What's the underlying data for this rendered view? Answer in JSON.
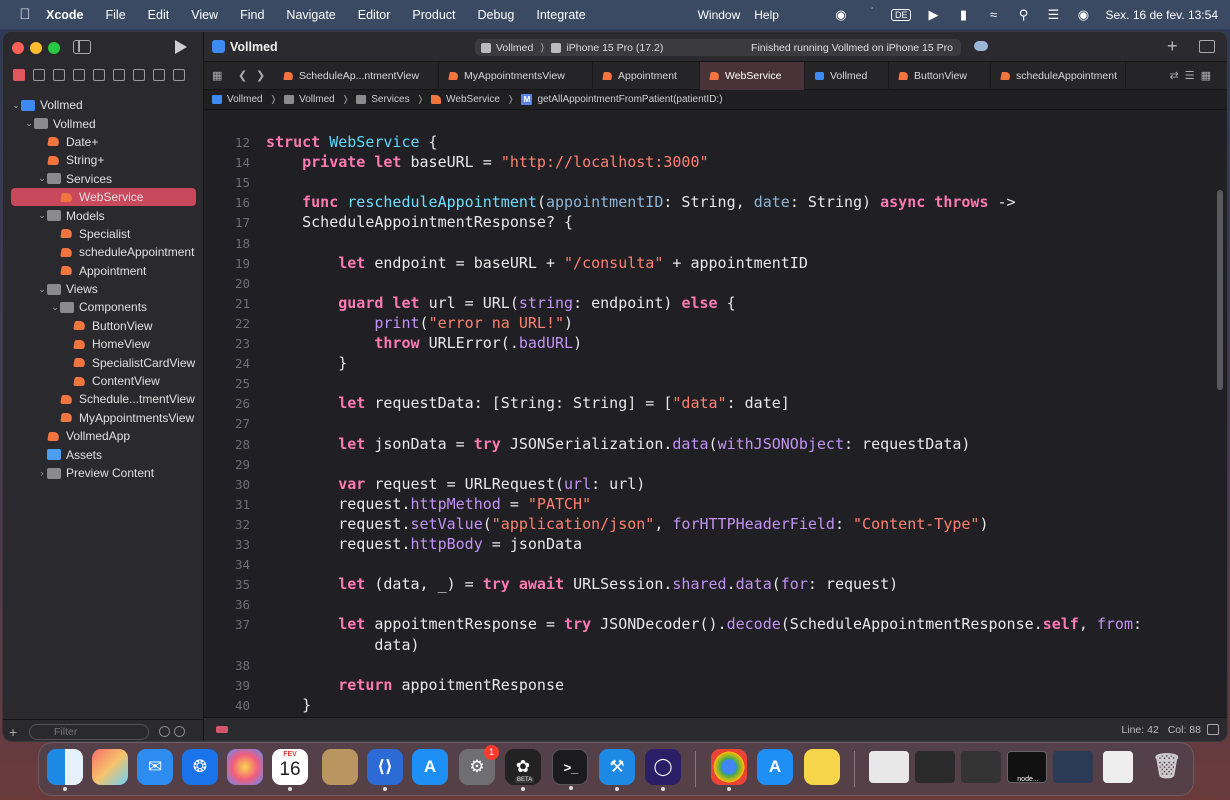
{
  "menubar": {
    "app": "Xcode",
    "items": [
      "File",
      "Edit",
      "View",
      "Find",
      "Navigate",
      "Editor",
      "Product",
      "Debug",
      "Integrate"
    ],
    "right_items": [
      "Window",
      "Help"
    ],
    "keyboard": "DE",
    "datetime": "Sex. 16 de fev.  13:54"
  },
  "toolbar": {
    "project": "Vollmed",
    "scheme": "Vollmed",
    "device": "iPhone 15 Pro (17.2)",
    "status": "Finished running Vollmed on iPhone 15 Pro"
  },
  "tabs": [
    {
      "label": "ScheduleAp...ntmentView",
      "active": false
    },
    {
      "label": "MyAppointmentsView",
      "active": false
    },
    {
      "label": "Appointment",
      "active": false
    },
    {
      "label": "WebService",
      "active": true
    },
    {
      "label": "Vollmed",
      "active": false
    },
    {
      "label": "ButtonView",
      "active": false
    },
    {
      "label": "scheduleAppointment",
      "active": false
    }
  ],
  "breadcrumb": [
    "Vollmed",
    "Vollmed",
    "Services",
    "WebService",
    "getAllAppointmentFromPatient(patientID:)"
  ],
  "navigator": {
    "items": [
      {
        "label": "Vollmed",
        "depth": 0,
        "kind": "proj",
        "open": true
      },
      {
        "label": "Vollmed",
        "depth": 1,
        "kind": "folder",
        "open": true
      },
      {
        "label": "Date+",
        "depth": 2,
        "kind": "swift"
      },
      {
        "label": "String+",
        "depth": 2,
        "kind": "swift"
      },
      {
        "label": "Services",
        "depth": 2,
        "kind": "folder",
        "open": true
      },
      {
        "label": "WebService",
        "depth": 3,
        "kind": "swift",
        "selected": true
      },
      {
        "label": "Models",
        "depth": 2,
        "kind": "folder",
        "open": true
      },
      {
        "label": "Specialist",
        "depth": 3,
        "kind": "swift"
      },
      {
        "label": "scheduleAppointment",
        "depth": 3,
        "kind": "swift"
      },
      {
        "label": "Appointment",
        "depth": 3,
        "kind": "swift"
      },
      {
        "label": "Views",
        "depth": 2,
        "kind": "folder",
        "open": true
      },
      {
        "label": "Components",
        "depth": 3,
        "kind": "folder",
        "open": true
      },
      {
        "label": "ButtonView",
        "depth": 4,
        "kind": "swift"
      },
      {
        "label": "HomeView",
        "depth": 4,
        "kind": "swift"
      },
      {
        "label": "SpecialistCardView",
        "depth": 4,
        "kind": "swift"
      },
      {
        "label": "ContentView",
        "depth": 4,
        "kind": "swift"
      },
      {
        "label": "Schedule...tmentView",
        "depth": 3,
        "kind": "swift"
      },
      {
        "label": "MyAppointmentsView",
        "depth": 3,
        "kind": "swift"
      },
      {
        "label": "VollmedApp",
        "depth": 2,
        "kind": "swift"
      },
      {
        "label": "Assets",
        "depth": 2,
        "kind": "assets"
      },
      {
        "label": "Preview Content",
        "depth": 2,
        "kind": "folder",
        "open": false
      }
    ],
    "filter_placeholder": "Filter"
  },
  "editor": {
    "lines": [
      {
        "n": "12",
        "segs": [
          [
            "kw",
            "struct "
          ],
          [
            "hdr",
            "WebService"
          ],
          [
            "pl",
            " {"
          ]
        ]
      },
      {
        "n": "14",
        "segs": [
          [
            "pl",
            "    "
          ],
          [
            "kw",
            "private let "
          ],
          [
            "pl",
            "baseURL = "
          ],
          [
            "str",
            "\"http://localhost:3000\""
          ]
        ]
      },
      {
        "n": "15",
        "segs": []
      },
      {
        "n": "16",
        "segs": [
          [
            "pl",
            "    "
          ],
          [
            "kw",
            "func "
          ],
          [
            "nm",
            "rescheduleAppointment"
          ],
          [
            "pl",
            "("
          ],
          [
            "prm",
            "appointmentID"
          ],
          [
            "pl",
            ": String, "
          ],
          [
            "prm",
            "date"
          ],
          [
            "pl",
            ": String) "
          ],
          [
            "kw",
            "async throws"
          ],
          [
            "pl",
            " ->"
          ]
        ]
      },
      {
        "n": "17",
        "segs": [
          [
            "pl",
            "    ScheduleAppointmentResponse? {"
          ]
        ]
      },
      {
        "n": "18",
        "segs": []
      },
      {
        "n": "19",
        "segs": [
          [
            "pl",
            "        "
          ],
          [
            "kw",
            "let "
          ],
          [
            "pl",
            "endpoint = baseURL + "
          ],
          [
            "str",
            "\"/consulta\""
          ],
          [
            "pl",
            " + appointmentID"
          ]
        ]
      },
      {
        "n": "20",
        "segs": []
      },
      {
        "n": "21",
        "segs": [
          [
            "pl",
            "        "
          ],
          [
            "kw",
            "guard let "
          ],
          [
            "pl",
            "url = URL("
          ],
          [
            "ac",
            "string"
          ],
          [
            "pl",
            ": endpoint) "
          ],
          [
            "kw",
            "else"
          ],
          [
            "pl",
            " {"
          ]
        ]
      },
      {
        "n": "22",
        "segs": [
          [
            "pl",
            "            "
          ],
          [
            "ac",
            "print"
          ],
          [
            "pl",
            "("
          ],
          [
            "str",
            "\"error na URL!\""
          ],
          [
            "pl",
            ")"
          ]
        ]
      },
      {
        "n": "23",
        "segs": [
          [
            "pl",
            "            "
          ],
          [
            "kw",
            "throw "
          ],
          [
            "pl",
            "URLError(."
          ],
          [
            "ac",
            "badURL"
          ],
          [
            "pl",
            ")"
          ]
        ]
      },
      {
        "n": "24",
        "segs": [
          [
            "pl",
            "        }"
          ]
        ]
      },
      {
        "n": "25",
        "segs": []
      },
      {
        "n": "26",
        "segs": [
          [
            "pl",
            "        "
          ],
          [
            "kw",
            "let "
          ],
          [
            "pl",
            "requestData: [String: String] = ["
          ],
          [
            "str",
            "\"data\""
          ],
          [
            "pl",
            ": date]"
          ]
        ]
      },
      {
        "n": "27",
        "segs": []
      },
      {
        "n": "28",
        "segs": [
          [
            "pl",
            "        "
          ],
          [
            "kw",
            "let "
          ],
          [
            "pl",
            "jsonData = "
          ],
          [
            "kw",
            "try "
          ],
          [
            "pl",
            "JSONSerialization."
          ],
          [
            "ac",
            "data"
          ],
          [
            "pl",
            "("
          ],
          [
            "ac",
            "withJSONObject"
          ],
          [
            "pl",
            ": requestData)"
          ]
        ]
      },
      {
        "n": "29",
        "segs": []
      },
      {
        "n": "30",
        "segs": [
          [
            "pl",
            "        "
          ],
          [
            "kw",
            "var "
          ],
          [
            "pl",
            "request = URLRequest("
          ],
          [
            "ac",
            "url"
          ],
          [
            "pl",
            ": url)"
          ]
        ]
      },
      {
        "n": "31",
        "segs": [
          [
            "pl",
            "        request."
          ],
          [
            "ac",
            "httpMethod"
          ],
          [
            "pl",
            " = "
          ],
          [
            "str",
            "\"PATCH\""
          ]
        ]
      },
      {
        "n": "32",
        "segs": [
          [
            "pl",
            "        request."
          ],
          [
            "ac",
            "setValue"
          ],
          [
            "pl",
            "("
          ],
          [
            "str",
            "\"application/json\""
          ],
          [
            "pl",
            ", "
          ],
          [
            "ac",
            "forHTTPHeaderField"
          ],
          [
            "pl",
            ": "
          ],
          [
            "str",
            "\"Content-Type\""
          ],
          [
            "pl",
            ")"
          ]
        ]
      },
      {
        "n": "33",
        "segs": [
          [
            "pl",
            "        request."
          ],
          [
            "ac",
            "httpBody"
          ],
          [
            "pl",
            " = jsonData"
          ]
        ]
      },
      {
        "n": "34",
        "segs": []
      },
      {
        "n": "35",
        "segs": [
          [
            "pl",
            "        "
          ],
          [
            "kw",
            "let "
          ],
          [
            "pl",
            "(data, _) = "
          ],
          [
            "kw",
            "try await "
          ],
          [
            "pl",
            "URLSession."
          ],
          [
            "ac",
            "shared"
          ],
          [
            "pl",
            "."
          ],
          [
            "ac",
            "data"
          ],
          [
            "pl",
            "("
          ],
          [
            "ac",
            "for"
          ],
          [
            "pl",
            ": request)"
          ]
        ]
      },
      {
        "n": "36",
        "segs": []
      },
      {
        "n": "37",
        "segs": [
          [
            "pl",
            "        "
          ],
          [
            "kw",
            "let "
          ],
          [
            "pl",
            "appoitmentResponse = "
          ],
          [
            "kw",
            "try "
          ],
          [
            "pl",
            "JSONDecoder()."
          ],
          [
            "ac",
            "decode"
          ],
          [
            "pl",
            "(ScheduleAppointmentResponse."
          ],
          [
            "kw",
            "self"
          ],
          [
            "pl",
            ", "
          ],
          [
            "ac",
            "from"
          ],
          [
            "pl",
            ":"
          ]
        ]
      },
      {
        "n": "",
        "segs": [
          [
            "pl",
            "            data)"
          ]
        ]
      },
      {
        "n": "38",
        "segs": []
      },
      {
        "n": "39",
        "segs": [
          [
            "pl",
            "        "
          ],
          [
            "kw",
            "return "
          ],
          [
            "pl",
            "appoitmentResponse"
          ]
        ]
      },
      {
        "n": "40",
        "segs": [
          [
            "pl",
            "    }"
          ]
        ]
      },
      {
        "n": "41",
        "segs": []
      }
    ]
  },
  "statusbar": {
    "line": "Line: 42",
    "col": "Col: 88"
  },
  "dock": {
    "calendar_month": "FEV",
    "calendar_day": "16",
    "settings_badge": "1",
    "beta_label": "BETA",
    "node_label": "node..."
  },
  "colors": {
    "keyword": "#ff7ab2",
    "string": "#ff8170",
    "selection": "#c7495b"
  }
}
